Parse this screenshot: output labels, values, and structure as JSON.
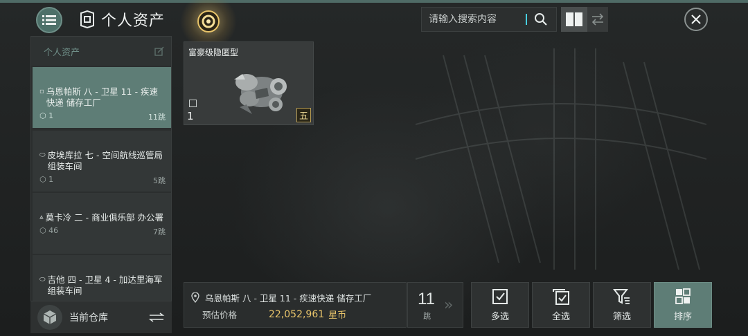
{
  "header": {
    "title": "个人资产",
    "search": {
      "placeholder": "请输入搜索内容",
      "value": ""
    }
  },
  "sidebar": {
    "header_label": "个人资产",
    "items": [
      {
        "icon": "station-icon",
        "name": "乌恩帕斯 八 - 卫星 11 - 疾速快递 储存工厂",
        "count": "1",
        "jumps": "11跳",
        "active": true
      },
      {
        "icon": "station-icon",
        "name": "皮埃库拉 七 - 空间航线巡管局 组装车间",
        "count": "1",
        "jumps": "5跳",
        "active": false
      },
      {
        "icon": "station-icon",
        "name": "莫卡冷 二 - 商业俱乐部 办公署",
        "count": "46",
        "jumps": "7跳",
        "active": false
      },
      {
        "icon": "station-icon",
        "name": "吉他 四 - 卫星 4 - 加达里海军 组装车间",
        "count": "",
        "jumps": "",
        "active": false
      }
    ],
    "footer_label": "当前仓库"
  },
  "assets": [
    {
      "name": "富豪级隐匿型",
      "quantity": "1",
      "tech_level": "五"
    }
  ],
  "bottom_bar": {
    "location": "乌恩帕斯 八 - 卫星 11 - 疾速快递 储存工厂",
    "price_label": "预估价格",
    "price_value": "22,052,961",
    "price_unit": "星币",
    "jumps": "11",
    "jumps_unit": "跳"
  },
  "actions": [
    {
      "label": "多选",
      "icon": "multi-select-icon",
      "active": false
    },
    {
      "label": "全选",
      "icon": "select-all-icon",
      "active": false
    },
    {
      "label": "筛选",
      "icon": "filter-icon",
      "active": false
    },
    {
      "label": "排序",
      "icon": "sort-icon",
      "active": true
    }
  ],
  "colors": {
    "accent": "#5e7d76",
    "price": "#e8c46a",
    "background": "#1f2222"
  }
}
